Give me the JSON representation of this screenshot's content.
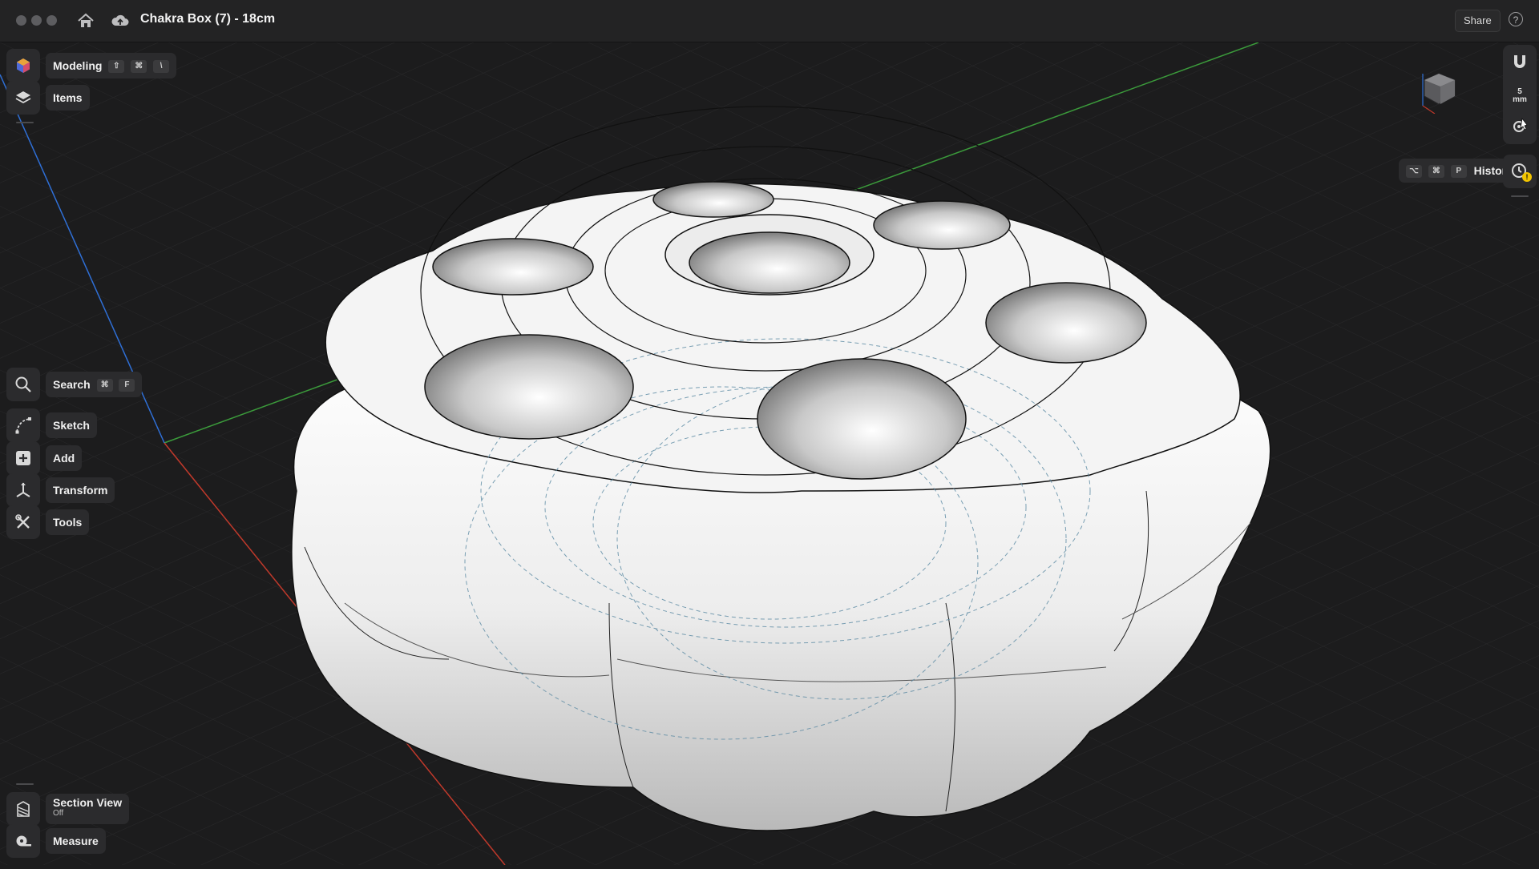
{
  "window": {
    "title": "Chakra Box (7) - 18cm",
    "share_label": "Share",
    "help_glyph": "?",
    "icons": [
      "home-icon",
      "cloud-upload-icon"
    ]
  },
  "left_toolbar": {
    "modeling": {
      "label": "Modeling",
      "keys": [
        "⇧",
        "⌘",
        "\\"
      ],
      "icon": "modeling-cube-icon"
    },
    "items": {
      "label": "Items",
      "icon": "layers-icon"
    },
    "search": {
      "label": "Search",
      "keys": [
        "⌘",
        "F"
      ],
      "icon": "search-icon"
    },
    "sketch": {
      "label": "Sketch",
      "icon": "sketch-icon"
    },
    "add": {
      "label": "Add",
      "icon": "plus-square-icon"
    },
    "transform": {
      "label": "Transform",
      "icon": "transform-icon"
    },
    "tools": {
      "label": "Tools",
      "icon": "tools-icon"
    },
    "section_view": {
      "label": "Section View",
      "status": "Off",
      "icon": "section-view-icon"
    },
    "measure": {
      "label": "Measure",
      "icon": "measure-tape-icon"
    }
  },
  "right_toolbar": {
    "snap_value": "5",
    "snap_unit": "mm",
    "history": {
      "label": "History",
      "keys": [
        "⌥",
        "⌘",
        "P"
      ],
      "badge": "!",
      "icon": "history-clock-icon"
    },
    "icons": [
      "magnet-icon",
      "snap-settings-icon",
      "view-cube-icon"
    ]
  },
  "colors": {
    "background": "#1c1c1d",
    "axis_x": "#c0392b",
    "axis_y": "#3b9a3b",
    "axis_z": "#2f6fd6",
    "model": "#f2f2f2",
    "warning_badge": "#f2c500"
  }
}
